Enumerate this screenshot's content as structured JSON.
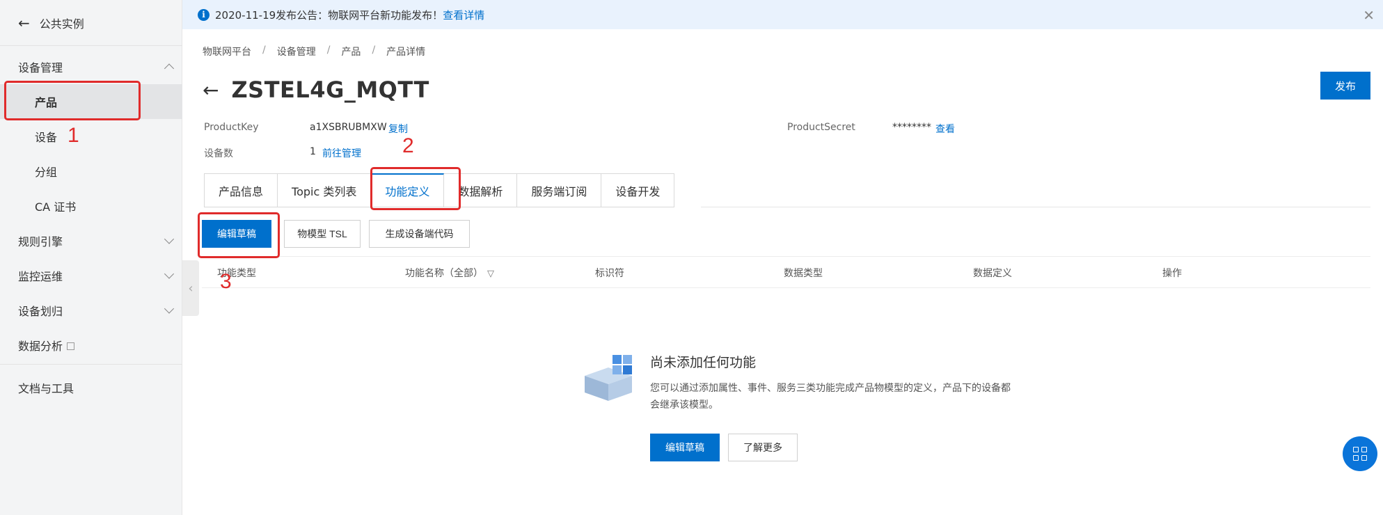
{
  "sidebar": {
    "back_label": "公共实例",
    "sections": {
      "device_mgmt": "设备管理",
      "products": "产品",
      "devices": "设备",
      "groups": "分组",
      "ca_cert": "CA 证书",
      "rule_engine": "规则引擎",
      "monitoring": "监控运维",
      "device_attribution": "设备划归",
      "data_analysis": "数据分析",
      "docs_tools": "文档与工具"
    }
  },
  "notice": {
    "text": "2020-11-19发布公告：物联网平台新功能发布！",
    "link": "查看详情"
  },
  "breadcrumb": [
    "物联网平台",
    "设备管理",
    "产品",
    "产品详情"
  ],
  "header": {
    "title": "ZSTEL4G_MQTT",
    "publish_label": "发布"
  },
  "product": {
    "key_label": "ProductKey",
    "key_value": "a1XSBRUBMXW",
    "copy_label": "复制",
    "secret_label": "ProductSecret",
    "secret_value": "********",
    "view_label": "查看",
    "device_count_label": "设备数",
    "device_count_value": "1",
    "manage_label": "前往管理"
  },
  "tabs": [
    "产品信息",
    "Topic 类列表",
    "功能定义",
    "数据解析",
    "服务端订阅",
    "设备开发"
  ],
  "toolbar": {
    "edit_draft": "编辑草稿",
    "tsl": "物模型 TSL",
    "gen_code": "生成设备端代码"
  },
  "table": {
    "columns": [
      "功能类型",
      "功能名称（全部）",
      "标识符",
      "数据类型",
      "数据定义",
      "操作"
    ]
  },
  "empty_state": {
    "title": "尚未添加任何功能",
    "description": "您可以通过添加属性、事件、服务三类功能完成产品物模型的定义，产品下的设备都会继承该模型。",
    "edit_draft": "编辑草稿",
    "learn_more": "了解更多"
  },
  "annotations": [
    "1",
    "2",
    "3"
  ],
  "colors": {
    "accent": "#0070cc",
    "annotation": "#e02b2b",
    "notice_bg": "#e9f2fd",
    "sidebar_bg": "#f3f4f5"
  }
}
